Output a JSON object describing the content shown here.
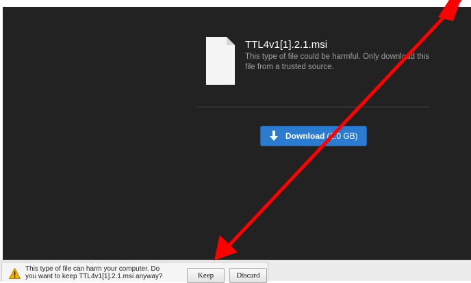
{
  "page": {
    "file_name": "TTL4v1[1].2.1.msi",
    "warning": "This type of file could be harmful. Only download this file from a trusted source.",
    "download_button": {
      "label": "Download",
      "size": "(1.0 GB)"
    }
  },
  "download_bar": {
    "message_line1": "This type of file can harm your computer. Do",
    "message_line2": "you want to keep TTL4v1[1].2.1.msi anyway?",
    "keep_label": "Keep",
    "discard_label": "Discard"
  },
  "icons": {
    "file": "file-icon",
    "download": "download-arrow-icon",
    "warning": "warning-icon"
  },
  "colors": {
    "page_background": "#222222",
    "download_button": "#2b7bd1",
    "warning_icon": "#f0b400",
    "annotation_arrow": "#ff0000"
  }
}
